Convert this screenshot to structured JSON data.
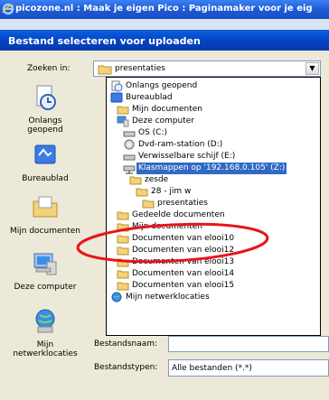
{
  "browser": {
    "title": "picozone.nl : Maak je eigen Pico : Paginamaker voor je eig"
  },
  "dialog": {
    "title": "Bestand selecteren voor uploaden",
    "lookin_label": "Zoeken in:",
    "lookin_value": "presentaties"
  },
  "places": [
    {
      "label": "Onlangs\ngeopend",
      "icon": "recent-icon"
    },
    {
      "label": "Bureaublad",
      "icon": "desktop-icon"
    },
    {
      "label": "Mijn documenten",
      "icon": "my-documents-icon"
    },
    {
      "label": "Deze computer",
      "icon": "my-computer-icon"
    },
    {
      "label": "Mijn\nnetwerklocaties",
      "icon": "network-icon"
    }
  ],
  "dropdown_items": [
    {
      "label": "Onlangs geopend",
      "icon": "recent-icon",
      "indent": 0
    },
    {
      "label": "Bureaublad",
      "icon": "desktop-icon",
      "indent": 0
    },
    {
      "label": "Mijn documenten",
      "icon": "folder-icon",
      "indent": 1
    },
    {
      "label": "Deze computer",
      "icon": "computer-icon",
      "indent": 1
    },
    {
      "label": "OS (C:)",
      "icon": "drive-icon",
      "indent": 2
    },
    {
      "label": "Dvd-ram-station (D:)",
      "icon": "dvd-icon",
      "indent": 2
    },
    {
      "label": "Verwisselbare schijf (E:)",
      "icon": "drive-icon",
      "indent": 2
    },
    {
      "label": "Klasmappen op '192.168.0.105' (Z:)",
      "icon": "network-drive-icon",
      "indent": 2,
      "selected": true
    },
    {
      "label": "zesde",
      "icon": "folder-icon",
      "indent": 3
    },
    {
      "label": "28 - jim w",
      "icon": "folder-icon",
      "indent": 4
    },
    {
      "label": "presentaties",
      "icon": "folder-icon",
      "indent": 5
    },
    {
      "label": "Gedeelde documenten",
      "icon": "folder-icon",
      "indent": 1
    },
    {
      "label": "Mijn documenten",
      "icon": "folder-icon",
      "indent": 1
    },
    {
      "label": "Documenten van elooi10",
      "icon": "folder-icon",
      "indent": 1
    },
    {
      "label": "Documenten van elooi12",
      "icon": "folder-icon",
      "indent": 1
    },
    {
      "label": "Documenten van elooi13",
      "icon": "folder-icon",
      "indent": 1
    },
    {
      "label": "Documenten van elooi14",
      "icon": "folder-icon",
      "indent": 1
    },
    {
      "label": "Documenten van elooi15",
      "icon": "folder-icon",
      "indent": 1
    },
    {
      "label": "Mijn netwerklocaties",
      "icon": "network-icon",
      "indent": 0
    }
  ],
  "filename_label": "Bestandsnaam:",
  "filetype_label": "Bestandstypen:",
  "filetype_value": "Alle bestanden (*.*)",
  "colors": {
    "selection": "#316ac5",
    "annotation": "#e8141b"
  }
}
